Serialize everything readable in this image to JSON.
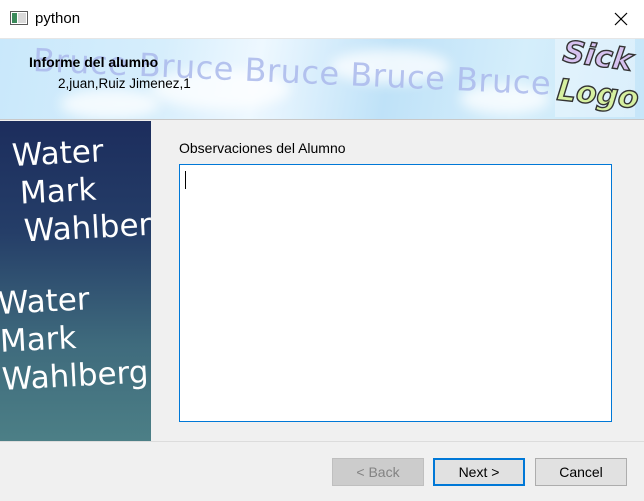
{
  "window": {
    "title": "python",
    "app_icon": "window-app-icon",
    "close_icon": "close-icon"
  },
  "banner": {
    "title": "Informe del alumno",
    "subtitle": "2,juan,Ruiz Jimenez,1",
    "watermark": "Bruce Bruce Bruce Bruce Bruce",
    "logo_line1": "Sick",
    "logo_line2": "Logo"
  },
  "side_panel": {
    "watermark_1": [
      "Water",
      "Mark",
      "Wahlberg"
    ],
    "watermark_2": [
      "Water",
      "Mark",
      "Wahlberg"
    ]
  },
  "main": {
    "observations_label": "Observaciones del Alumno",
    "observations_value": ""
  },
  "buttons": {
    "back": "< Back",
    "next": "Next >",
    "cancel": "Cancel"
  },
  "colors": {
    "accent": "#0078d7",
    "side_top": "#1c2d5d",
    "side_bottom": "#4c7f86"
  }
}
